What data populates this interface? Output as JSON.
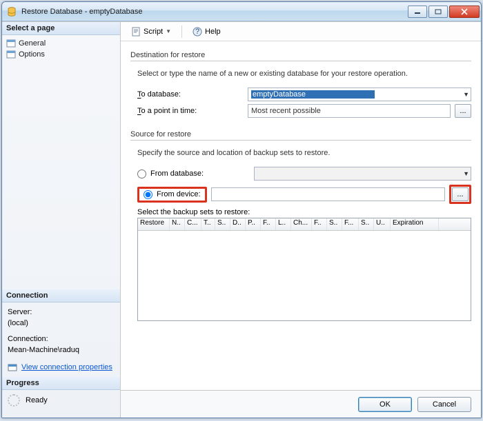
{
  "window": {
    "title": "Restore Database - emptyDatabase"
  },
  "sidebar": {
    "select_page_header": "Select a page",
    "pages": [
      {
        "label": "General"
      },
      {
        "label": "Options"
      }
    ],
    "connection_header": "Connection",
    "server_label": "Server:",
    "server_value": "(local)",
    "connection_label": "Connection:",
    "connection_value": "Mean-Machine\\raduq",
    "view_conn_props": "View connection properties",
    "progress_header": "Progress",
    "progress_status": "Ready"
  },
  "toolbar": {
    "script_label": "Script",
    "help_label": "Help"
  },
  "main": {
    "dest_group": "Destination for restore",
    "dest_desc": "Select or type the name of a new or existing database for your restore operation.",
    "to_database_label": "To database:",
    "to_database_value": "emptyDatabase",
    "to_point_label": "To a point in time:",
    "to_point_value": "Most recent possible",
    "src_group": "Source for restore",
    "src_desc": "Specify the source and location of backup sets to restore.",
    "from_database_label": "From database:",
    "from_device_label": "From device:",
    "from_device_value": "",
    "table_caption": "Select the backup sets to restore:",
    "columns": [
      "Restore",
      "N..",
      "C...",
      "T..",
      "S..",
      "D..",
      "P..",
      "F..",
      "L..",
      "Ch...",
      "F..",
      "S..",
      "F...",
      "S..",
      "U..",
      "Expiration"
    ]
  },
  "footer": {
    "ok_label": "OK",
    "cancel_label": "Cancel"
  },
  "ellipsis": "..."
}
